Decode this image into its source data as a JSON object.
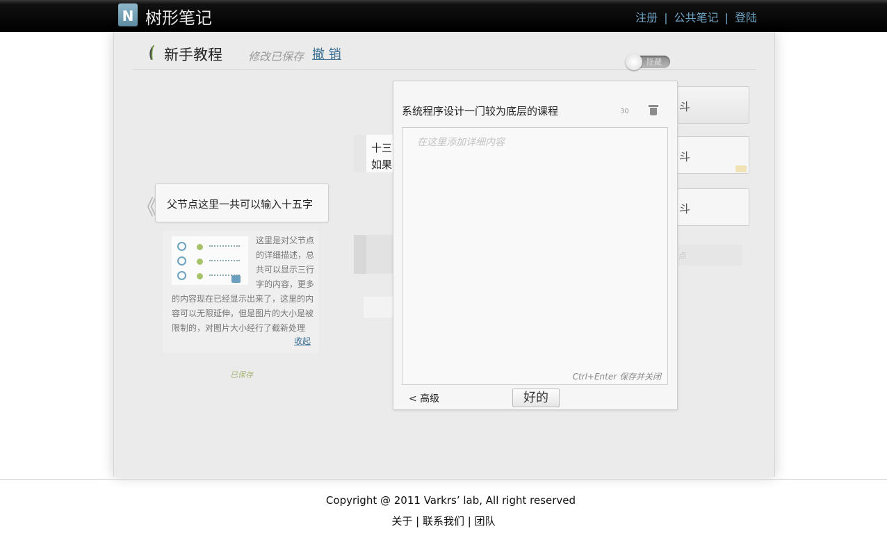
{
  "app": {
    "logo_letter": "N",
    "name": "树形笔记"
  },
  "topnav": {
    "register": "注册",
    "public_notes": "公共笔记",
    "login": "登陆",
    "separator": "|"
  },
  "header": {
    "title": "新手教程",
    "status": "修改已保存",
    "undo": "撤 销",
    "toggle_label": "隐藏"
  },
  "tree": {
    "nav_prev": "《",
    "parent_node": "父节点这里一共可以输入十五字",
    "detail_text": "这里是对父节点的详细描述，总共可以显示三行字的内容，更多的内容现在已经显示出来了，这里的内容可以无限延伸，但是图片的大小是被限制的，对图片大小经行了截新处理",
    "collapse": "收起",
    "saved": "已保存",
    "child_a_line1": "十三",
    "child_a_line2": "如果",
    "right_nodes": [
      "斗",
      "斗",
      "斗"
    ],
    "right_ghost": "点"
  },
  "editor": {
    "title": "系统程序设计一门较为底层的课程",
    "char_count": "30",
    "placeholder": "在这里添加详细内容",
    "hint": "Ctrl+Enter 保存并关闭",
    "advanced": "< 高级",
    "ok": "好的"
  },
  "footer": {
    "copyright": "Copyright  @ 2011 Varkrs’ lab, All right reserved",
    "about": "关于",
    "contact": "联系我们",
    "team": "团队",
    "separator": "|"
  }
}
